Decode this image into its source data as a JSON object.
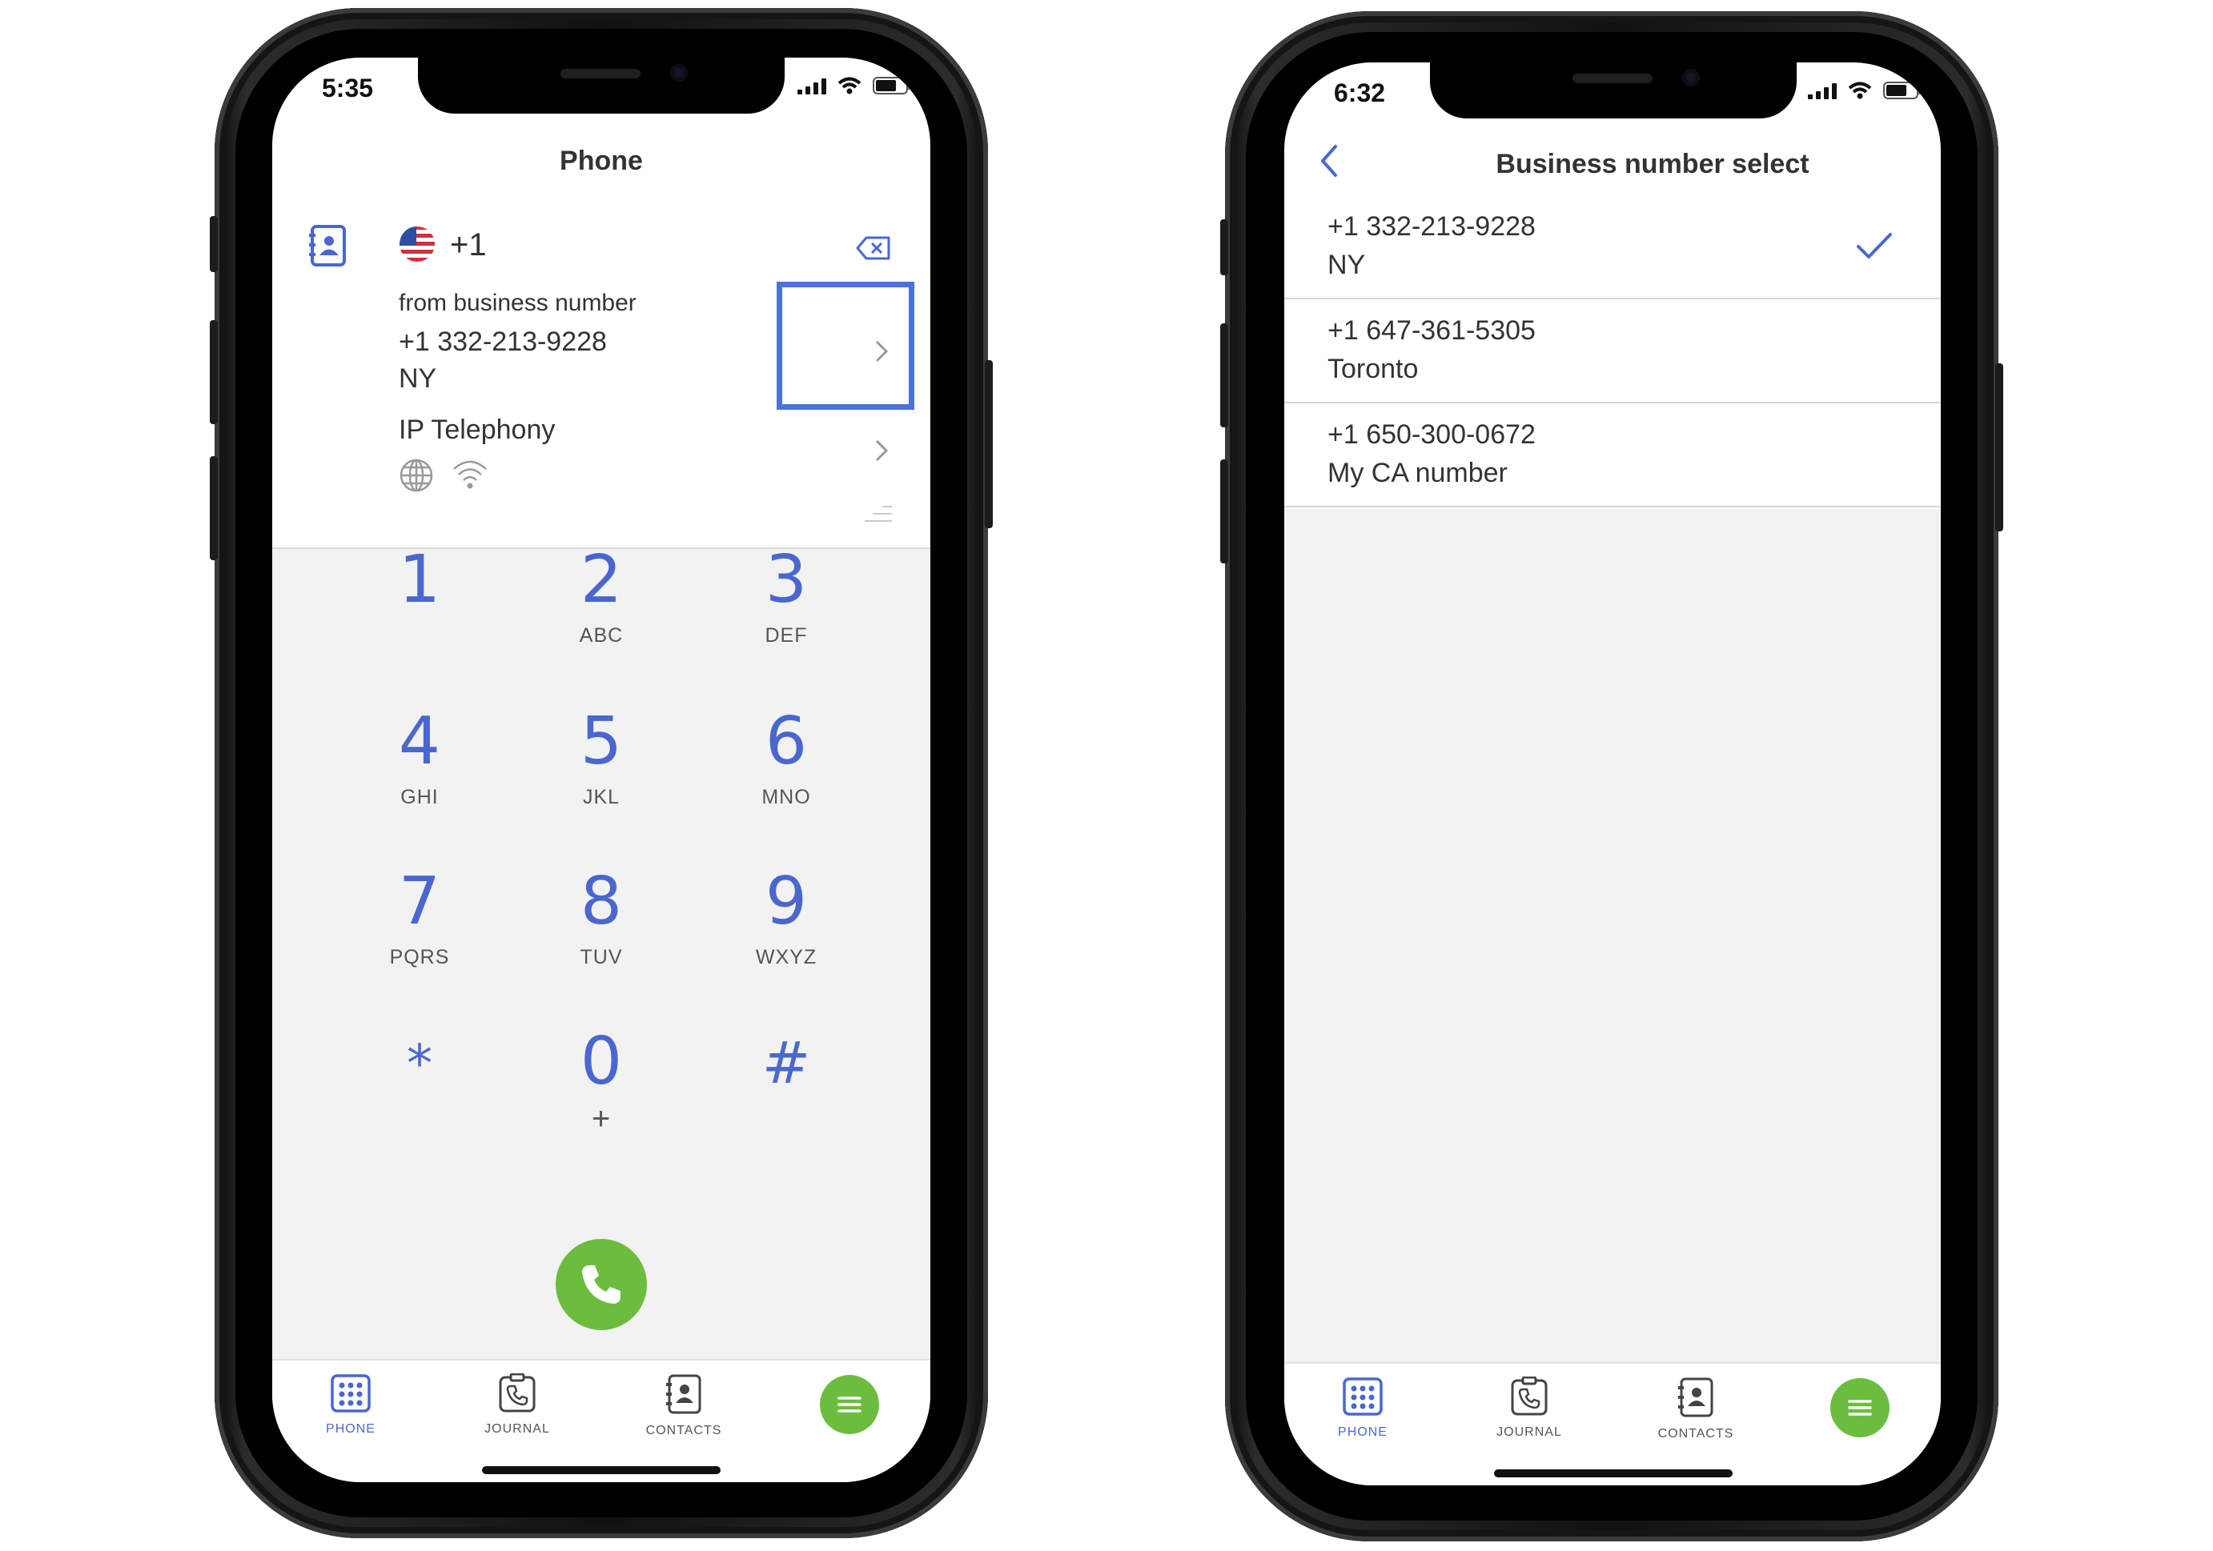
{
  "phone1": {
    "status_time": "5:35",
    "title": "Phone",
    "country_code": "+1",
    "from_label": "from business number",
    "business_number": "+1 332-213-9228",
    "business_location": "NY",
    "route_label": "IP Telephony",
    "keys": [
      {
        "digit": "1",
        "letters": ""
      },
      {
        "digit": "2",
        "letters": "ABC"
      },
      {
        "digit": "3",
        "letters": "DEF"
      },
      {
        "digit": "4",
        "letters": "GHI"
      },
      {
        "digit": "5",
        "letters": "JKL"
      },
      {
        "digit": "6",
        "letters": "MNO"
      },
      {
        "digit": "7",
        "letters": "PQRS"
      },
      {
        "digit": "8",
        "letters": "TUV"
      },
      {
        "digit": "9",
        "letters": "WXYZ"
      },
      {
        "digit": "*",
        "letters": ""
      },
      {
        "digit": "0",
        "letters": "+"
      },
      {
        "digit": "#",
        "letters": ""
      }
    ],
    "tabs": [
      {
        "label": "PHONE",
        "icon": "dialpad-icon"
      },
      {
        "label": "JOURNAL",
        "icon": "journal-icon"
      },
      {
        "label": "CONTACTS",
        "icon": "contacts-icon"
      }
    ]
  },
  "phone2": {
    "status_time": "6:32",
    "title": "Business number select",
    "numbers": [
      {
        "number": "+1 332-213-9228",
        "location": "NY",
        "selected": true
      },
      {
        "number": "+1 647-361-5305",
        "location": "Toronto",
        "selected": false
      },
      {
        "number": "+1 650-300-0672",
        "location": "My CA number",
        "selected": false
      }
    ],
    "tabs": [
      {
        "label": "PHONE",
        "icon": "dialpad-icon"
      },
      {
        "label": "JOURNAL",
        "icon": "journal-icon"
      },
      {
        "label": "CONTACTS",
        "icon": "contacts-icon"
      }
    ]
  },
  "colors": {
    "accent": "#4a67cf",
    "call_green": "#6cbd3e",
    "highlight": "#4a72d8"
  }
}
